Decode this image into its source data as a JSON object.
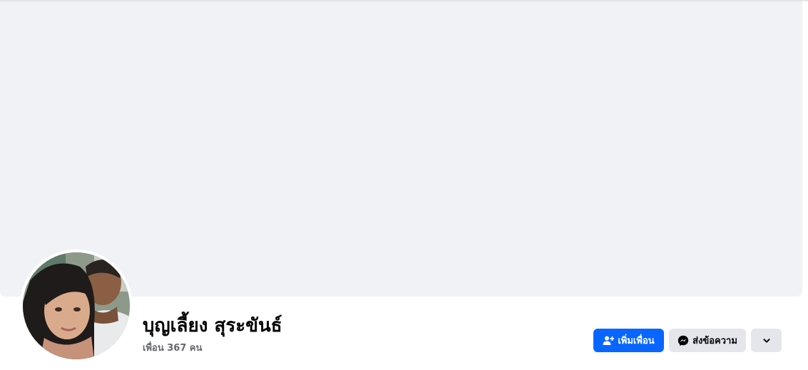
{
  "profile": {
    "name": "บุญเลี้ยง สุระขันธ์",
    "friends_count_text": "เพื่อน 367 คน"
  },
  "actions": {
    "add_friend_label": "เพิ่มเพื่อน",
    "add_friend_icon": "add-friend-icon",
    "message_label": "ส่งข้อความ",
    "message_icon": "messenger-icon",
    "more_icon": "chevron-down-icon"
  },
  "colors": {
    "cover_bg": "#f0f2f5",
    "primary_button": "#0866ff",
    "secondary_button": "#e4e6eb",
    "secondary_text": "#65676b"
  }
}
